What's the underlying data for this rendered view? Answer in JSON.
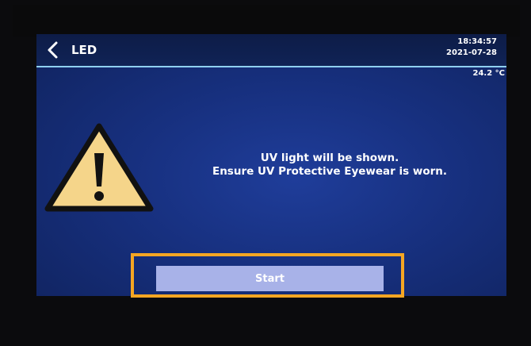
{
  "header": {
    "back_icon": "chevron-left-icon",
    "title": "LED",
    "time": "18:34:57",
    "date": "2021-07-28",
    "temperature": "24.2 °C"
  },
  "warning": {
    "icon": "warning-triangle-icon",
    "icon_color": "#f5d58a",
    "line1": "UV light will be shown.",
    "line2": "Ensure UV Protective Eyewear is worn."
  },
  "actions": {
    "start_label": "Start",
    "highlight_color": "#f5a623"
  }
}
